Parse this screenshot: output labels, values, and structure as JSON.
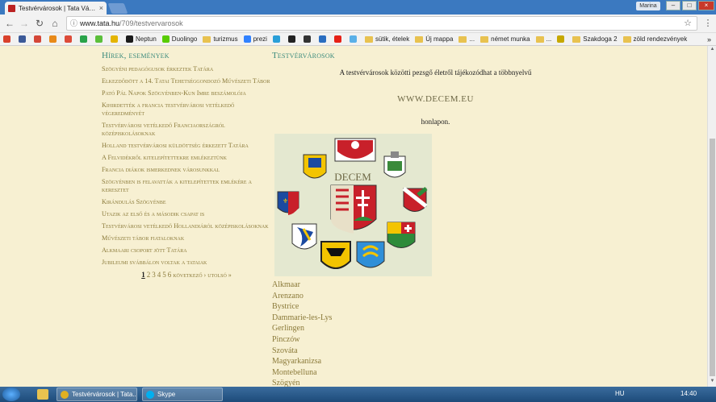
{
  "browser": {
    "tab_title": "Testvérvárosok | Tata Vá…",
    "tab_close": "×",
    "profile": "Marina",
    "window_min": "–",
    "window_max": "□",
    "window_close": "×",
    "url_host": "www.tata.hu",
    "url_path": "/709/testvervarosok",
    "back": "←",
    "forward": "→",
    "reload": "↻",
    "home": "⌂",
    "info": "ⓘ",
    "star": "☆",
    "menu": "⋮",
    "bookmarks_more": "»",
    "bookmarks": [
      {
        "label": "",
        "color": "#d9412c"
      },
      {
        "label": "",
        "color": "#3b5998"
      },
      {
        "label": "",
        "color": "#d44638"
      },
      {
        "label": "",
        "color": "#e88a1a"
      },
      {
        "label": "",
        "color": "#dd4b39"
      },
      {
        "label": "",
        "color": "#29a34a"
      },
      {
        "label": "",
        "color": "#5bbf3b"
      },
      {
        "label": "",
        "color": "#e4b400"
      },
      {
        "label": "Neptun",
        "color": "#1a1a1a"
      },
      {
        "label": "Duolingo",
        "color": "#58cc02"
      },
      {
        "label": "turizmus",
        "folder": true
      },
      {
        "label": "prezi",
        "color": "#3181ff"
      },
      {
        "label": "",
        "color": "#2a9fd8"
      },
      {
        "label": "",
        "color": "#222222"
      },
      {
        "label": "",
        "color": "#333333"
      },
      {
        "label": "",
        "color": "#2a6dc0"
      },
      {
        "label": "",
        "color": "#e62117"
      },
      {
        "label": "",
        "color": "#5ab0e8"
      },
      {
        "label": "sütik, ételek",
        "folder": true
      },
      {
        "label": "Új mappa",
        "folder": true
      },
      {
        "label": "...",
        "folder": true
      },
      {
        "label": "német munka",
        "folder": true
      },
      {
        "label": "...",
        "folder": true
      },
      {
        "label": "",
        "color": "#c6a800"
      },
      {
        "label": "Szakdoga 2",
        "folder": true
      },
      {
        "label": "zöld rendezvények",
        "folder": true
      }
    ]
  },
  "sidebar": {
    "title": "Hírek, események",
    "items": [
      "Szögyéni pedagógusok érkeztek Tatára",
      "Elkezdődött a 14. Tatai Tehetséggondozó Művészeti Tábor",
      "Pató Pál Napok Szögyénben-Kun Imre beszámolója",
      "Kihirdették a francia testvérvárosi vetélkedő végeredményét",
      "Testvérvárosi vetélkedő Franciaországról középiskolásoknak",
      "Holland testvérvárosi küldöttség érkezett Tatára",
      "A Felvidékről kitelepítettekre emlékeztünk",
      "Francia diákok ismerkednek városunkkal",
      "Szögyénben is felavatták a kitelepítettek emlékére a keresztet",
      "Kirándulás Szögyénbe",
      "Utazik az első és a második csapat is",
      "Testvérvárosi vetélkedő Hollandiáról középiskolásoknak",
      "Művészeti tábor fiataloknak",
      "Alkmaari csoport jött Tatára",
      "Jubileumi svábbálon voltak a tataiak"
    ],
    "pager": {
      "pages": [
        "1",
        "2",
        "3",
        "4",
        "5",
        "6"
      ],
      "next": "következő ›",
      "last": "utolsó »"
    }
  },
  "main": {
    "title": "Testvérvárosok",
    "intro": "A testvérvárosok közötti pezsgő életről tájékozódhat a többnyelvű",
    "link": "WWW.DECEM.EU",
    "outro": "honlapon.",
    "logo_text": "DECEM",
    "cities": [
      "Alkmaar",
      "Arenzano",
      "Bystrice",
      "Dammarie-les-Lys",
      "Gerlingen",
      "Pinczów",
      "Szováta",
      "Magyarkanizsa",
      "Montebelluna",
      "Szögyén"
    ]
  },
  "taskbar": {
    "tasks": [
      {
        "label": "Testvérvárosok | Tata...",
        "color": "#e0b020"
      },
      {
        "label": "Skype",
        "color": "#00aff0"
      }
    ],
    "lang": "HU",
    "time": "14:40"
  }
}
